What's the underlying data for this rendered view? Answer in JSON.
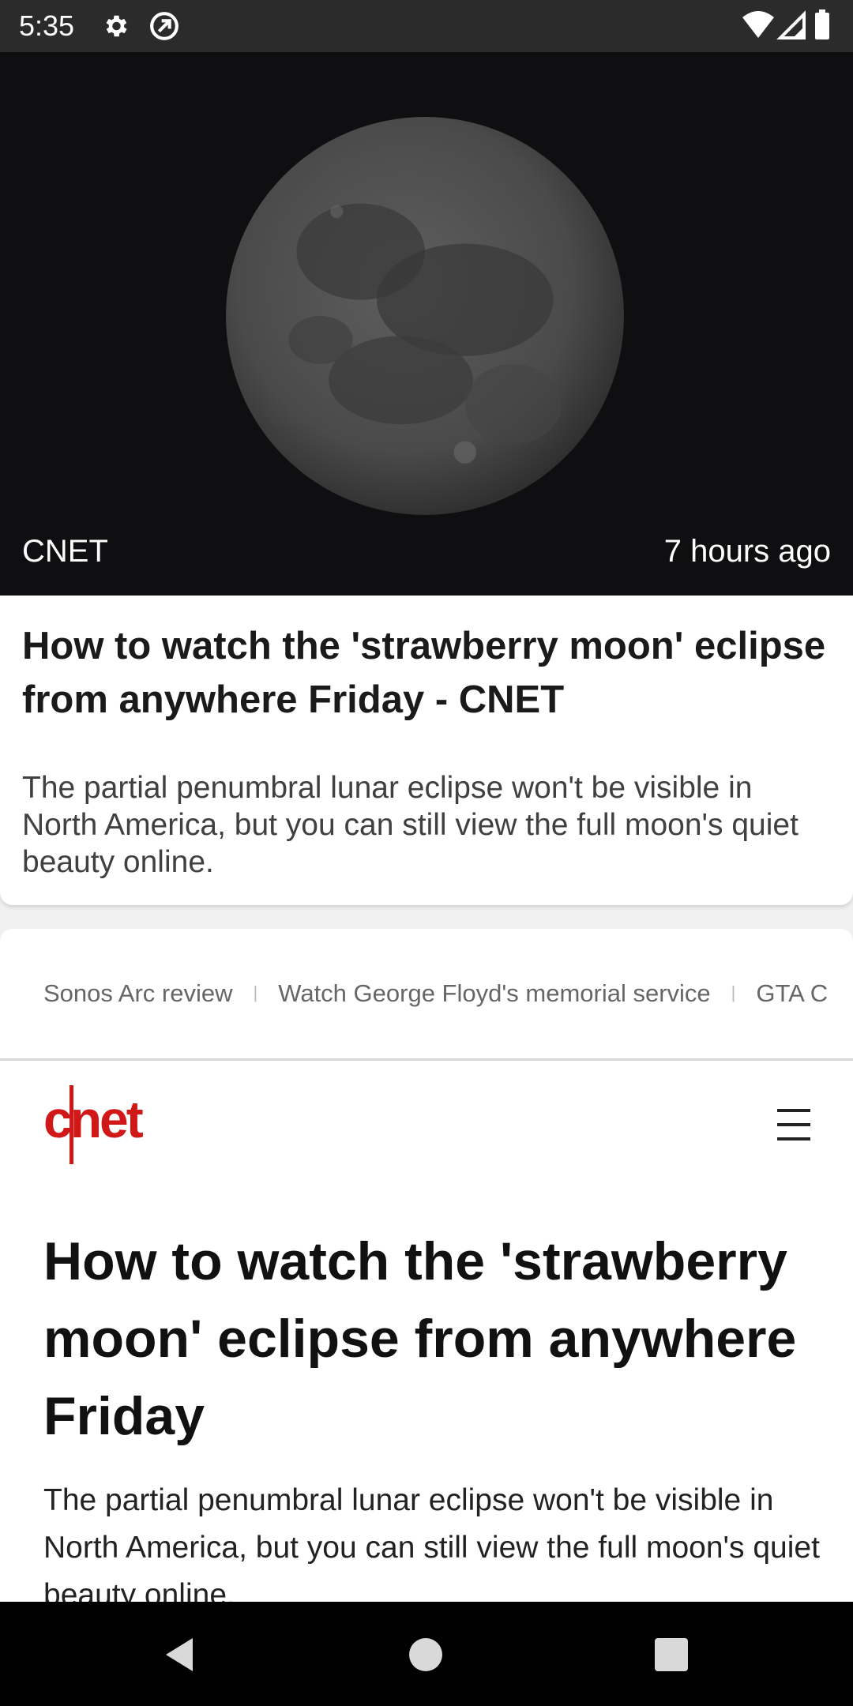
{
  "status_bar": {
    "time": "5:35",
    "icons": [
      "gear-icon",
      "sync-icon",
      "wifi-icon",
      "cellular-signal-icon",
      "battery-icon"
    ]
  },
  "hero": {
    "image": "moon-image",
    "source": "CNET",
    "time_ago": "7 hours ago",
    "title": "How to watch the 'strawberry moon' eclipse from anywhere Friday - CNET",
    "description": "The partial penumbral lunar eclipse won't be visible in North America, but you can still view the full moon's quiet beauty online."
  },
  "web": {
    "trending": [
      "Sonos Arc review",
      "Watch George Floyd's memorial service",
      "GTA C"
    ],
    "logo_text": "cnet",
    "brand_color": "#d11818",
    "article_title": "How to watch the 'strawberry moon' eclipse from anywhere Friday",
    "article_description": "The partial penumbral lunar eclipse won't be visible in North America, but you can still view the full moon's quiet beauty online."
  },
  "nav_bar": {
    "buttons": [
      "back-icon",
      "home-icon",
      "recents-icon"
    ]
  }
}
